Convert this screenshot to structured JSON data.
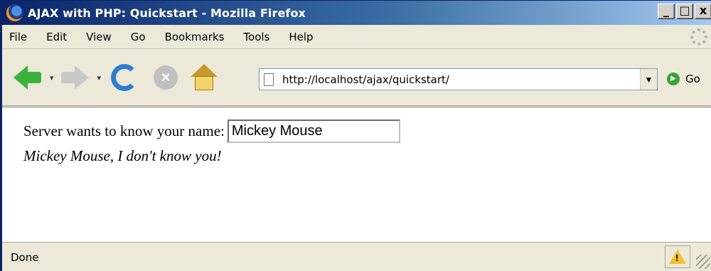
{
  "window": {
    "title": "AJAX with PHP: Quickstart - Mozilla Firefox"
  },
  "window_controls": {
    "minimize": "_",
    "maximize": "□",
    "close": "x"
  },
  "menu": [
    "File",
    "Edit",
    "View",
    "Go",
    "Bookmarks",
    "Tools",
    "Help"
  ],
  "toolbar": {
    "url": "http://localhost/ajax/quickstart/",
    "go_label": "Go",
    "icons": [
      "back-icon",
      "forward-icon",
      "reload-icon",
      "stop-icon",
      "home-icon",
      "page-icon",
      "go-icon"
    ]
  },
  "content": {
    "prompt": "Server wants to know your name:",
    "name_value": "Mickey Mouse",
    "response": "Mickey Mouse, I don't know you!"
  },
  "status": {
    "text": "Done"
  },
  "colors": {
    "title_bar_start": "#0a246a",
    "title_bar_end": "#a6caf0",
    "chrome": "#ece9d8",
    "back_arrow": "#3bb23b",
    "reload": "#2f7dd1"
  }
}
